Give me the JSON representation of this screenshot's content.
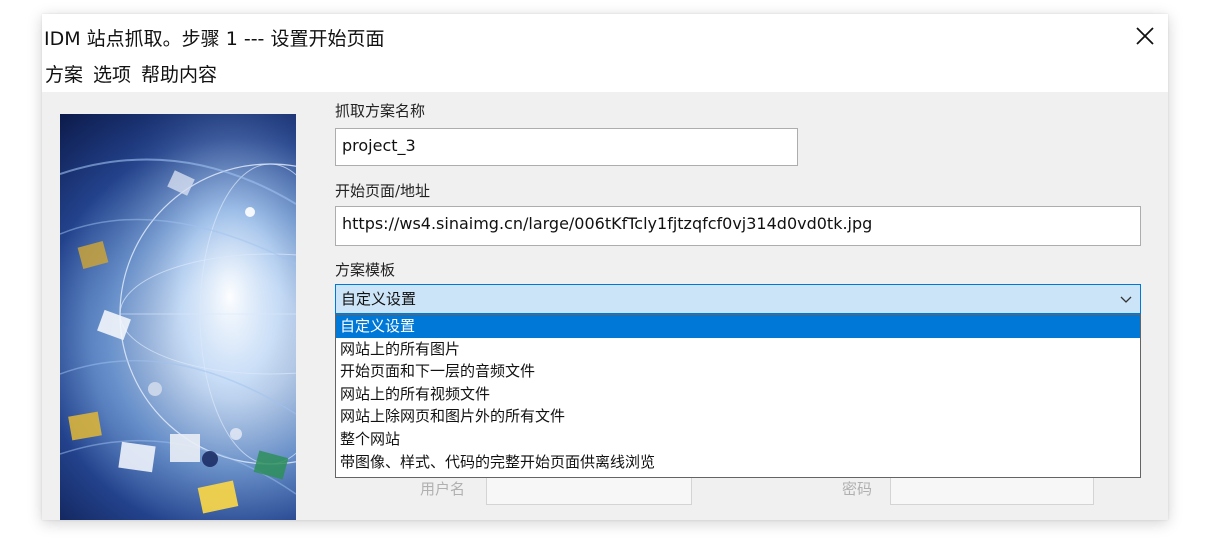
{
  "window": {
    "title": "IDM 站点抓取。步骤 1 --- 设置开始页面",
    "close_icon": "close-icon"
  },
  "menu": {
    "items": [
      "方案",
      "选项",
      "帮助内容"
    ]
  },
  "form": {
    "project_name_label": "抓取方案名称",
    "project_name_value": "project_3",
    "start_url_label": "开始页面/地址",
    "start_url_value": "https://ws4.sinaimg.cn/large/006tKfTcly1fjtzqfcf0vj314d0vd0tk.jpg",
    "template_label": "方案模板",
    "template_selected": "自定义设置",
    "template_options": [
      "自定义设置",
      "网站上的所有图片",
      "开始页面和下一层的音频文件",
      "网站上的所有视频文件",
      "网站上除网页和图片外的所有文件",
      "整个网站",
      "带图像、样式、代码的完整开始页面供离线浏览"
    ],
    "username_label": "用户名",
    "password_label": "密码"
  },
  "colors": {
    "accent": "#0078d7",
    "combo_bg": "#cce4f7",
    "dialog_bg": "#f0f0f0"
  }
}
